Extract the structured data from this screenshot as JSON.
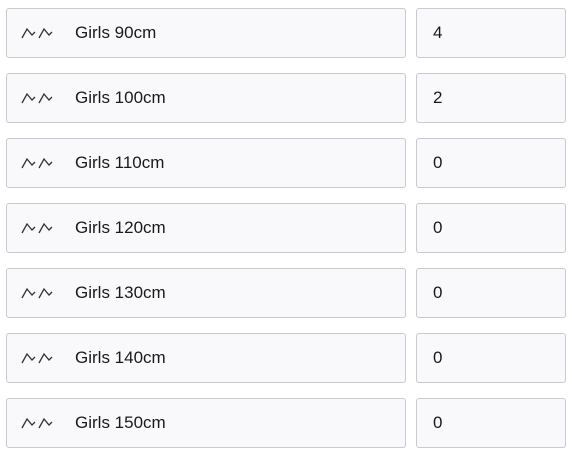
{
  "rows": [
    {
      "label": "Girls 90cm",
      "qty": "4",
      "handle_icon": "grip-icon"
    },
    {
      "label": "Girls 100cm",
      "qty": "2",
      "handle_icon": "grip-icon"
    },
    {
      "label": "Girls 110cm",
      "qty": "0",
      "handle_icon": "grip-icon"
    },
    {
      "label": "Girls 120cm",
      "qty": "0",
      "handle_icon": "grip-icon"
    },
    {
      "label": "Girls 130cm",
      "qty": "0",
      "handle_icon": "grip-icon"
    },
    {
      "label": "Girls 140cm",
      "qty": "0",
      "handle_icon": "grip-icon"
    },
    {
      "label": "Girls 150cm",
      "qty": "0",
      "handle_icon": "grip-icon"
    }
  ],
  "colors": {
    "border": "#c9c9cf",
    "field_bg": "#f9f9fb",
    "text": "#1a1a1a"
  }
}
